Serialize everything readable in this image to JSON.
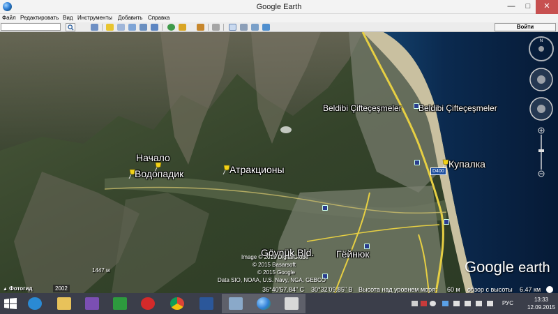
{
  "window": {
    "title": "Google Earth",
    "controls": {
      "minimize": "—",
      "maximize": "□",
      "close": "✕"
    }
  },
  "menu": {
    "items": [
      "Файл",
      "Редактировать",
      "Вид",
      "Инструменты",
      "Добавить",
      "Справка"
    ]
  },
  "toolbar": {
    "search_value": "",
    "login_label": "Войти",
    "icons": [
      "sidebar-icon",
      "placemark-icon",
      "polygon-icon",
      "path-icon",
      "image-overlay-icon",
      "tour-icon",
      "history-icon",
      "sun-icon",
      "planets-icon",
      "ruler-icon",
      "email-icon",
      "print-icon",
      "save-image-icon",
      "maps-icon"
    ]
  },
  "map": {
    "labels": {
      "start": "Начало",
      "waterfall": "Водопадик",
      "attractions": "Атракционы",
      "beach": "Купалка",
      "beldibi_1": "Beldibi Çifteçeşmeler",
      "beldibi_2": "Beldibi Çifteçeşmeler",
      "goynuk_latin": "Göynük Bld.",
      "goynuk_cyr": "Гёйнюк",
      "road": "D400"
    },
    "attribution": [
      "Image © 2015 DigitalGlobe",
      "© 2015 Basarsoft",
      "© 2015 Google",
      "Data SIO, NOAA, U.S. Navy, NGA, GEBCO"
    ],
    "elevation_marker": "1447 м",
    "logo": {
      "google": "Google",
      "earth": "earth"
    },
    "scale": "6.47 км",
    "photo_button": "Фотогид",
    "history_year": "2002"
  },
  "status": {
    "lat": "36°40'57.84\" С",
    "lon": "30°32'09.85\" В",
    "elevation_label": "Высота над уровнем моря:",
    "elevation_value": "60 м",
    "view_label": "обзор с высоты",
    "view_value": "6.47 км"
  },
  "taskbar": {
    "apps": [
      "internet-explorer",
      "file-explorer",
      "visual-studio",
      "store",
      "opera",
      "chrome",
      "word",
      "google-earth-pro",
      "google-earth",
      "camera"
    ],
    "language": "РУС",
    "time": "13:33",
    "date": "12.09.2015"
  },
  "colors": {
    "water": "#0b2a4f",
    "terrain": "#3d4a30",
    "road": "#e6cf43",
    "close_button": "#c75050",
    "taskbar": "#3b3e4a",
    "pin": "#f2d218"
  }
}
